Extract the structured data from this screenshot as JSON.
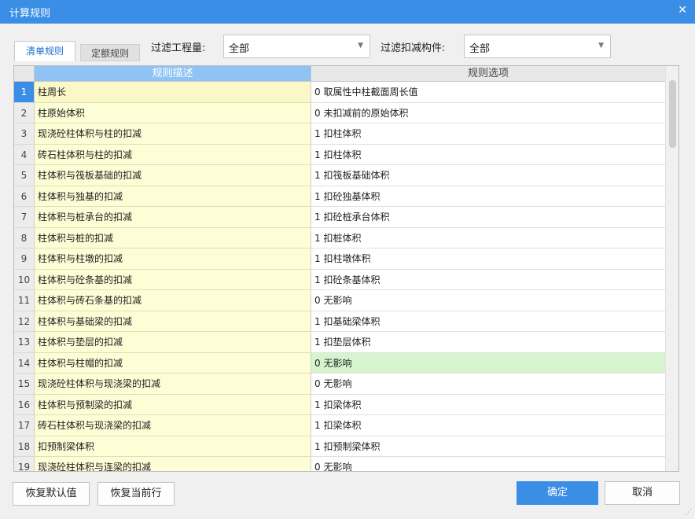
{
  "window": {
    "title": "计算规则",
    "close_glyph": "✕"
  },
  "tabs": [
    {
      "label": "清单规则",
      "active": true
    },
    {
      "label": "定额规则",
      "active": false
    }
  ],
  "filters": {
    "quantity": {
      "label": "过滤工程量:",
      "value": "全部"
    },
    "deduct": {
      "label": "过滤扣减构件:",
      "value": "全部"
    }
  },
  "grid": {
    "headers": {
      "rownum": "",
      "desc": "规则描述",
      "option": "规则选项"
    },
    "selected_row": 1,
    "highlight_row": 14,
    "rows": [
      {
        "n": "1",
        "desc": "柱周长",
        "option": "0 取属性中柱截面周长值"
      },
      {
        "n": "2",
        "desc": "柱原始体积",
        "option": "0 未扣减前的原始体积"
      },
      {
        "n": "3",
        "desc": "现浇砼柱体积与柱的扣减",
        "option": "1 扣柱体积"
      },
      {
        "n": "4",
        "desc": "砖石柱体积与柱的扣减",
        "option": "1 扣柱体积"
      },
      {
        "n": "5",
        "desc": "柱体积与筏板基础的扣减",
        "option": "1 扣筏板基础体积"
      },
      {
        "n": "6",
        "desc": "柱体积与独基的扣减",
        "option": "1 扣砼独基体积"
      },
      {
        "n": "7",
        "desc": "柱体积与桩承台的扣减",
        "option": "1 扣砼桩承台体积"
      },
      {
        "n": "8",
        "desc": "柱体积与桩的扣减",
        "option": "1 扣桩体积"
      },
      {
        "n": "9",
        "desc": "柱体积与柱墩的扣减",
        "option": "1 扣柱墩体积"
      },
      {
        "n": "10",
        "desc": "柱体积与砼条基的扣减",
        "option": "1 扣砼条基体积"
      },
      {
        "n": "11",
        "desc": "柱体积与砖石条基的扣减",
        "option": "0  无影响"
      },
      {
        "n": "12",
        "desc": "柱体积与基础梁的扣减",
        "option": "1 扣基础梁体积"
      },
      {
        "n": "13",
        "desc": "柱体积与垫层的扣减",
        "option": "1 扣垫层体积"
      },
      {
        "n": "14",
        "desc": "柱体积与柱帽的扣减",
        "option": "0  无影响"
      },
      {
        "n": "15",
        "desc": "现浇砼柱体积与现浇梁的扣减",
        "option": "0  无影响"
      },
      {
        "n": "16",
        "desc": "柱体积与预制梁的扣减",
        "option": "1 扣梁体积"
      },
      {
        "n": "17",
        "desc": "砖石柱体积与现浇梁的扣减",
        "option": "1 扣梁体积"
      },
      {
        "n": "18",
        "desc": "扣预制梁体积",
        "option": "1  扣预制梁体积"
      },
      {
        "n": "19",
        "desc": "现浇砼柱体积与连梁的扣减",
        "option": "0  无影响"
      }
    ]
  },
  "buttons": {
    "restore_default": "恢复默认值",
    "restore_current": "恢复当前行",
    "ok": "确定",
    "cancel": "取消"
  },
  "colors": {
    "accent": "#3a8ee6",
    "desc_bg": "#fdfdd6",
    "highlight_bg": "#d6f5cf",
    "header_desc": "#8ec3f3"
  }
}
